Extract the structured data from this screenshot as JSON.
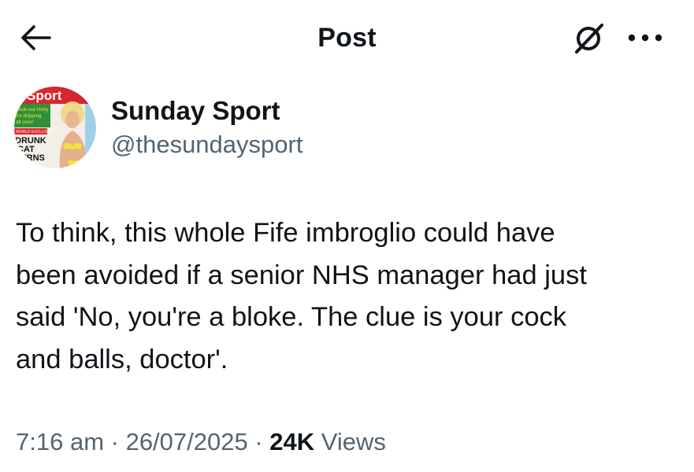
{
  "header": {
    "title": "Post",
    "back_icon": "arrow-left-icon",
    "grok_icon": "grok-icon",
    "more_icon": "more-horizontal-icon"
  },
  "author": {
    "name": "Sunday Sport",
    "handle": "@thesundaysport",
    "avatar": {
      "masthead": "Sport",
      "teaser": "Look out Holly it's dripping all over!",
      "sub": "WORLD EXCLUSIVE",
      "headline": "DRUNK CAT TURNS"
    }
  },
  "post": {
    "lines": [
      "To think, this whole Fife imbroglio could have",
      "been avoided if a senior NHS manager had just",
      "said 'No, you're a bloke. The clue is your cock",
      "and balls, doctor'."
    ]
  },
  "meta": {
    "time": "7:16 am",
    "sep1": " · ",
    "date": "26/07/2025",
    "sep2": " · ",
    "views_count": "24K",
    "views_label": " Views"
  },
  "colors": {
    "text_primary": "#0f1419",
    "text_secondary": "#536471",
    "background": "#ffffff"
  }
}
